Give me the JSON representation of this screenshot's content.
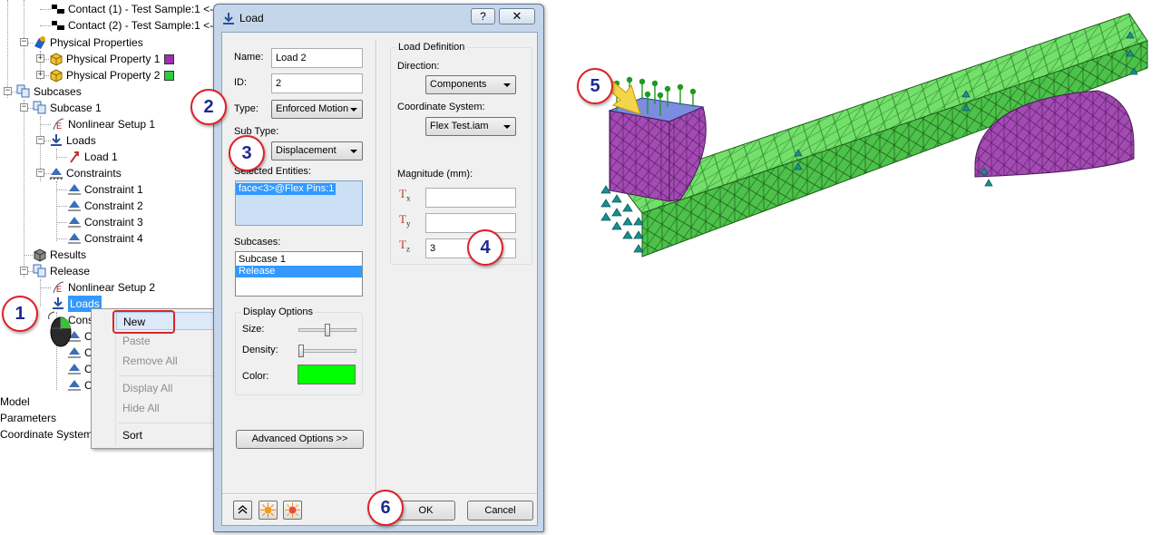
{
  "tree": {
    "items": [
      {
        "label": "Contact (1) - Test Sample:1 <-"
      },
      {
        "label": "Contact (2) - Test Sample:1 <-"
      },
      {
        "label": "Physical Properties"
      },
      {
        "label": "Physical Property 1",
        "swatch": "#9b30b0"
      },
      {
        "label": "Physical Property 2",
        "swatch": "#2ecc40"
      },
      {
        "label": "Subcases"
      },
      {
        "label": "Subcase 1"
      },
      {
        "label": "Nonlinear Setup 1"
      },
      {
        "label": "Loads"
      },
      {
        "label": "Load 1"
      },
      {
        "label": "Constraints"
      },
      {
        "label": "Constraint 1"
      },
      {
        "label": "Constraint 2"
      },
      {
        "label": "Constraint 3"
      },
      {
        "label": "Constraint 4"
      },
      {
        "label": "Results"
      },
      {
        "label": "Release"
      },
      {
        "label": "Nonlinear Setup 2"
      },
      {
        "label": "Loads"
      },
      {
        "label": "Cons"
      },
      {
        "label": "C"
      },
      {
        "label": "C"
      },
      {
        "label": "C"
      },
      {
        "label": "C"
      }
    ],
    "bottom": [
      "Model",
      "Parameters",
      "Coordinate System"
    ]
  },
  "context_menu": {
    "items": [
      "New",
      "Paste",
      "Remove All",
      "Display All",
      "Hide All",
      "Sort"
    ]
  },
  "dialog": {
    "title": "Load",
    "help_glyph": "?",
    "close_glyph": "✕",
    "name_label": "Name:",
    "name_value": "Load 2",
    "id_label": "ID:",
    "id_value": "2",
    "type_label": "Type:",
    "type_value": "Enforced Motion",
    "subtype_label": "Sub Type:",
    "subtype_value": "Displacement",
    "entities_label": "Selected Entities:",
    "entities": [
      "face<3>@Flex Pins:1"
    ],
    "subcases_label": "Subcases:",
    "subcases": [
      "Subcase 1",
      "Release"
    ],
    "display_options": {
      "title": "Display Options",
      "size_label": "Size:",
      "size_level": 0.5,
      "density_label": "Density:",
      "density_level": 0.0,
      "color_label": "Color:",
      "color": "#00ff00"
    },
    "advanced_label": "Advanced Options >>",
    "load_definition": {
      "title": "Load Definition",
      "direction_label": "Direction:",
      "direction_value": "Components",
      "coord_label": "Coordinate System:",
      "coord_value": "Flex Test.iam",
      "magnitude_label": "Magnitude (mm):",
      "tx_letter": "T",
      "tx_sub": "x",
      "tx_value": "",
      "ty_letter": "T",
      "ty_sub": "y",
      "ty_value": "",
      "tz_letter": "T",
      "tz_sub": "z",
      "tz_value": "3"
    },
    "ok_label": "OK",
    "cancel_label": "Cancel"
  },
  "callouts": [
    "1",
    "2",
    "3",
    "4",
    "5",
    "6"
  ],
  "colors": {
    "callout_border": "#e01f26",
    "callout_text": "#1d2a8f",
    "selection": "#3399ff",
    "mesh_top": "#6ee66e",
    "mesh_side": "#9b3fa8",
    "constraint": "#1a8f8f",
    "load_arrow": "#1f9a1f"
  }
}
